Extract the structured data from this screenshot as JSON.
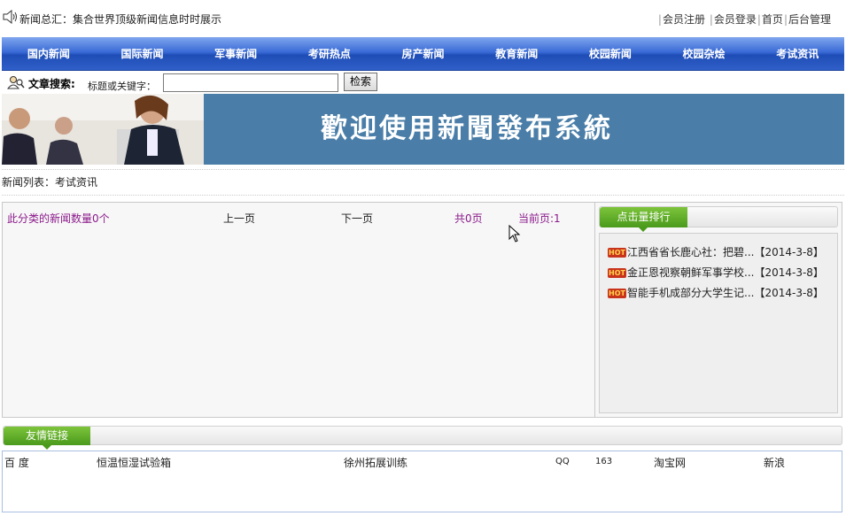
{
  "top": {
    "ticker": "新闻总汇：集合世界顶级新闻信息时时展示",
    "links": [
      "会员注册",
      "会员登录",
      "首页",
      "后台管理"
    ]
  },
  "nav": [
    "国内新闻",
    "国际新闻",
    "军事新闻",
    "考研热点",
    "房产新闻",
    "教育新闻",
    "校园新闻",
    "校园杂烩",
    "考试资讯"
  ],
  "search": {
    "title": "文章搜索:",
    "hint": "标题或关键字：",
    "value": "",
    "button": "检索"
  },
  "banner": {
    "title": "歡迎使用新聞發布系統"
  },
  "breadcrumb": "新闻列表：考试资讯",
  "pager": {
    "count": "此分类的新闻数量0个",
    "prev": "上一页",
    "next": "下一页",
    "total": "共0页",
    "current": "当前页:1"
  },
  "rank": {
    "title": "点击量排行",
    "badge": "HOT",
    "items": [
      {
        "title": "江西省省长鹿心社：把碧...",
        "date": "【2014-3-8】"
      },
      {
        "title": "金正恩视察朝鲜军事学校...",
        "date": "【2014-3-8】"
      },
      {
        "title": "智能手机成部分大学生记...",
        "date": "【2014-3-8】"
      }
    ]
  },
  "friend_links": {
    "title": "友情链接",
    "items": [
      "百 度",
      "恒温恒湿试验箱",
      "徐州拓展训练",
      "QQ",
      "163",
      "淘宝网",
      "新浪"
    ]
  },
  "colors": {
    "nav": "#2f5fc8",
    "banner": "#4a7ea8",
    "tab_green": "#5aad26",
    "accent_purple": "#8b1a8b"
  }
}
